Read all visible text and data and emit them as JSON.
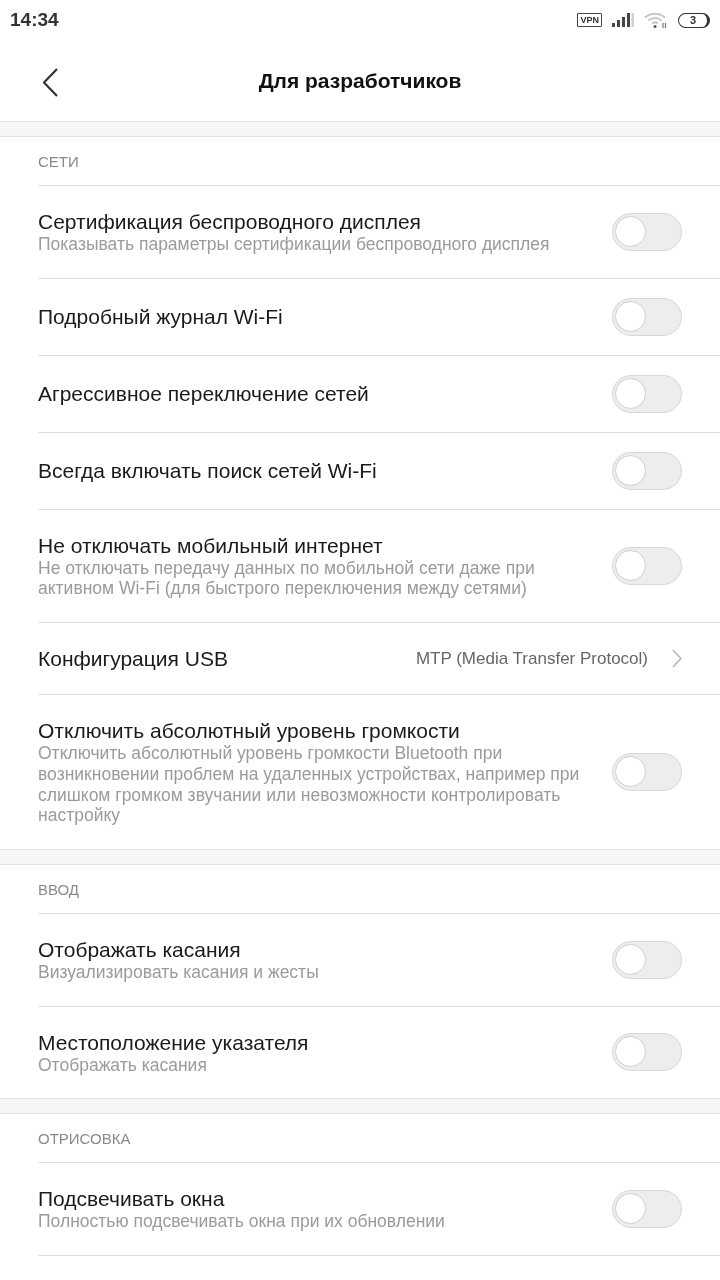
{
  "status_bar": {
    "time": "14:34",
    "vpn": "VPN",
    "battery": "3"
  },
  "header": {
    "title": "Для разработчиков"
  },
  "sections": [
    {
      "title": "СЕТИ",
      "items": [
        {
          "kind": "toggle",
          "title": "Сертификация беспроводного дисплея",
          "subtitle": "Показывать параметры сертификации беспроводного дисплея",
          "on": false
        },
        {
          "kind": "toggle",
          "title": "Подробный журнал Wi-Fi",
          "on": false
        },
        {
          "kind": "toggle",
          "title": "Агрессивное переключение сетей",
          "on": false
        },
        {
          "kind": "toggle",
          "title": "Всегда включать поиск сетей Wi-Fi",
          "on": false
        },
        {
          "kind": "toggle",
          "title": "Не отключать мобильный интернет",
          "subtitle": "Не отключать передачу данных по мобильной сети даже при активном Wi-Fi (для быстрого переключения между сетями)",
          "on": false
        },
        {
          "kind": "link",
          "title": "Конфигурация USB",
          "value": "MTP (Media Transfer Protocol)"
        },
        {
          "kind": "toggle",
          "title": "Отключить абсолютный уровень громкости",
          "subtitle": "Отключить абсолютный уровень громкости Bluetooth при возникновении проблем на удаленных устройствах, например при слишком громком звучании или невозможности контролировать настройку",
          "on": false
        }
      ]
    },
    {
      "title": "ВВОД",
      "items": [
        {
          "kind": "toggle",
          "title": "Отображать касания",
          "subtitle": "Визуализировать касания и жесты",
          "on": false
        },
        {
          "kind": "toggle",
          "title": "Местоположение указателя",
          "subtitle": "Отображать касания",
          "on": false
        }
      ]
    },
    {
      "title": "ОТРИСОВКА",
      "items": [
        {
          "kind": "toggle",
          "title": "Подсвечивать окна",
          "subtitle": "Полностью подсвечивать окна при их обновлении",
          "on": false
        }
      ]
    }
  ]
}
